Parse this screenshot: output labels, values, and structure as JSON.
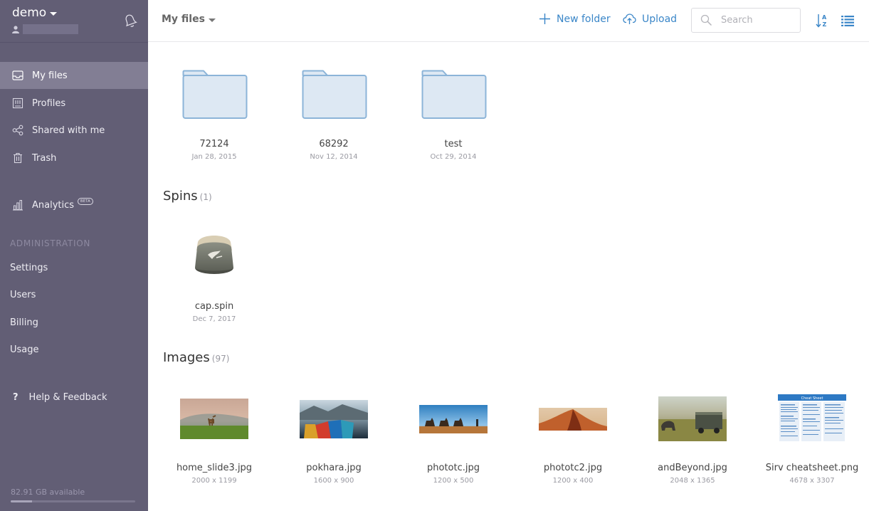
{
  "account": {
    "name": "demo"
  },
  "sidebar": {
    "items": [
      {
        "label": "My files",
        "icon": "inbox-icon"
      },
      {
        "label": "Profiles",
        "icon": "profiles-icon"
      },
      {
        "label": "Shared with me",
        "icon": "share-icon"
      },
      {
        "label": "Trash",
        "icon": "trash-icon"
      }
    ],
    "analytics": {
      "label": "Analytics",
      "badge": "BETA"
    },
    "admin_heading": "ADMINISTRATION",
    "admin_items": [
      "Settings",
      "Users",
      "Billing",
      "Usage"
    ],
    "help": {
      "icon_text": "?",
      "label": "Help & Feedback"
    },
    "storage": {
      "text": "82.91 GB available",
      "used_fraction": 0.17
    }
  },
  "topbar": {
    "breadcrumb": "My files",
    "new_folder_label": "New folder",
    "upload_label": "Upload",
    "search_placeholder": "Search"
  },
  "folders": [
    {
      "name": "72124",
      "date": "Jan 28, 2015"
    },
    {
      "name": "68292",
      "date": "Nov 12, 2014"
    },
    {
      "name": "test",
      "date": "Oct 29, 2014"
    }
  ],
  "spins": {
    "title": "Spins",
    "count": "(1)",
    "items": [
      {
        "name": "cap.spin",
        "date": "Dec 7, 2017"
      }
    ]
  },
  "images": {
    "title": "Images",
    "count": "(97)",
    "items": [
      {
        "name": "home_slide3.jpg",
        "dims": "2000 x 1199"
      },
      {
        "name": "pokhara.jpg",
        "dims": "1600 x 900"
      },
      {
        "name": "phototc.jpg",
        "dims": "1200 x 500"
      },
      {
        "name": "phototc2.jpg",
        "dims": "1200 x 400"
      },
      {
        "name": "andBeyond.jpg",
        "dims": "2048 x 1365"
      },
      {
        "name": "Sirv cheatsheet.png",
        "dims": "4678 x 3307",
        "heading": "Cheat Sheet"
      }
    ]
  },
  "colors": {
    "sidebar_bg": "#625e75",
    "sidebar_active": "#827e94",
    "accent": "#3a86c8",
    "folder_fill": "#dde8f3",
    "folder_stroke": "#8cb4d8"
  }
}
